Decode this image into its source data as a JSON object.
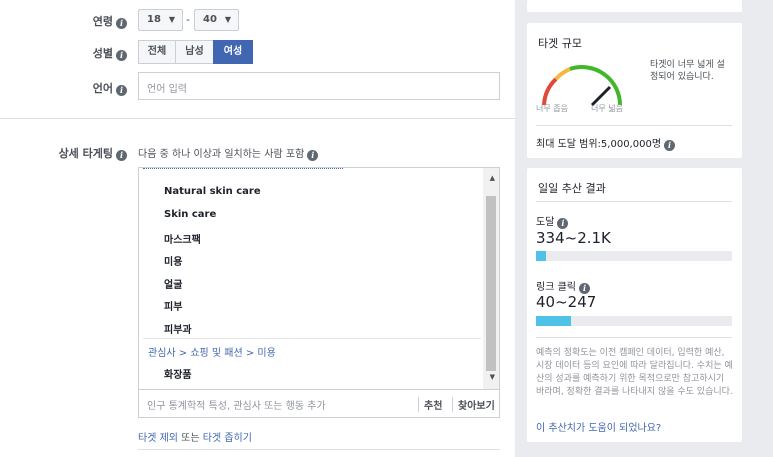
{
  "form": {
    "age_label": "연령",
    "age_min": "18",
    "age_sep": "-",
    "age_max": "40",
    "gender_label": "성별",
    "gender_options": [
      "전체",
      "남성",
      "여성"
    ],
    "gender_selected": "여성",
    "language_label": "언어",
    "language_placeholder": "언어 입력",
    "detail_label": "상세 타게팅",
    "detail_description": "다음 중 하나 이상과 일치하는 사람 포함",
    "detail_items_top": [
      "Natural skin care",
      "Skin care",
      "마스크팩",
      "미용",
      "얼굴",
      "피부",
      "피부과"
    ],
    "breadcrumb": "관심사 > 쇼핑 및 패션 > 미용",
    "detail_items_bottom": [
      "화장품"
    ],
    "detail_placeholder": "인구 통계학적 특성, 관심사 또는 행동 추가",
    "recommend_label": "추천",
    "browse_label": "찾아보기",
    "exclude_link": "타겟 제외",
    "or_text": "또는",
    "narrow_link": "타겟 좁히기"
  },
  "audience_size": {
    "title": "타겟 규모",
    "gauge_message": "타겟이 너무 넓게 설정되어 있습니다.",
    "narrow_label": "너무 좁음",
    "broad_label": "너무 넓음",
    "potential_reach": "최대 도달 범위:5,000,000명"
  },
  "daily_results": {
    "title": "일일 추산 결과",
    "reach_label": "도달",
    "reach_value": "334~2.1K",
    "reach_fill": 0.05,
    "clicks_label": "링크 클릭",
    "clicks_value": "40~247",
    "clicks_fill": 0.18,
    "note": "예측의 정확도는 이전 캠페인 데이터, 입력한 예산, 시장 데이터 등의 요인에 따라 달라집니다. 수치는 예산의 성과를 예측하기 위한 목적으로만 참고하시기 바라며, 정확한 결과를 나타내지 않을 수도 있습니다.",
    "feedback_link": "이 추산치가 도움이 되었나요?"
  },
  "colors": {
    "accent": "#4267b2",
    "bar": "#4fc3e7",
    "gauge_red": "#e04a3b",
    "gauge_yellow": "#f6b73c",
    "gauge_green": "#42b72a"
  }
}
